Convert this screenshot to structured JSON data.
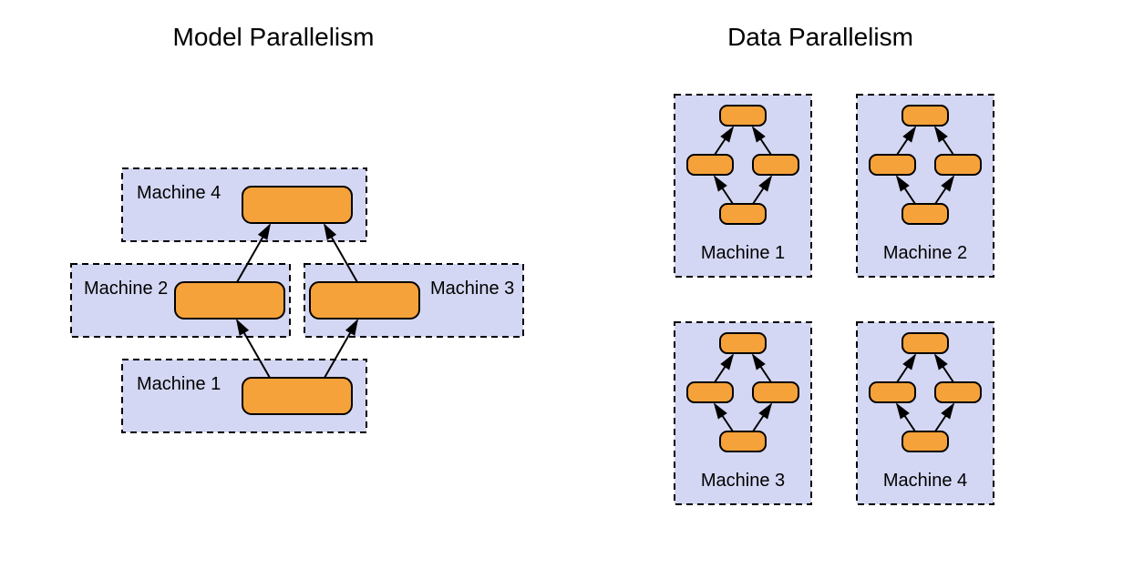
{
  "left": {
    "title": "Model Parallelism",
    "machines": [
      "Machine 1",
      "Machine 2",
      "Machine 3",
      "Machine 4"
    ]
  },
  "right": {
    "title": "Data Parallelism",
    "machines": [
      "Machine 1",
      "Machine 2",
      "Machine 3",
      "Machine 4"
    ]
  },
  "colors": {
    "box_fill": "#d4d7f3",
    "node_fill": "#f6a23a"
  }
}
